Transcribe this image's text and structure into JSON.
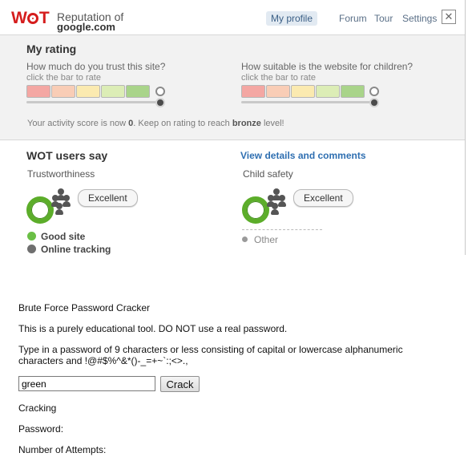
{
  "header": {
    "logo": "WOT",
    "title": "Reputation of",
    "site": "google.com",
    "nav": {
      "my_profile": "My profile",
      "forum": "Forum",
      "tour": "Tour",
      "settings": "Settings"
    },
    "close_glyph": "✕"
  },
  "my_rating": {
    "heading": "My rating",
    "trust_question": "How much do you trust this site?",
    "child_question": "How suitable is the website for children?",
    "hint": "click the bar to rate",
    "bar_colors": [
      "#f4a7a3",
      "#f9cdb6",
      "#fbeab0",
      "#dcedb6",
      "#a9d48a"
    ],
    "activity_prefix": "Your activity score is now",
    "activity_score": "0",
    "activity_middle": ". Keep on rating to reach",
    "activity_level": "bronze",
    "activity_suffix": "level!"
  },
  "users_say": {
    "heading": "WOT users say",
    "details_link": "View details and comments",
    "trust": {
      "label": "Trustworthiness",
      "rating": "Excellent"
    },
    "child": {
      "label": "Child safety",
      "rating": "Excellent"
    },
    "legend": [
      {
        "label": "Good site",
        "color": "#6abf45"
      },
      {
        "label": "Online tracking",
        "color": "#6f6f6f"
      }
    ],
    "child_other": "Other"
  },
  "page": {
    "title": "Brute Force Password Cracker",
    "warning": "This is a purely educational tool. DO NOT use a real password.",
    "instructions_line1": "Type in a password of 9 characters or less consisting of capital or lowercase alphanumeric",
    "instructions_line2": "characters and !@#$%^&*()-_=+~`:;<>.,",
    "input_value": "green",
    "crack_label": "Crack",
    "cracking_label": "Cracking",
    "password_label": "Password:",
    "attempts_label": "Number of Attempts:"
  }
}
